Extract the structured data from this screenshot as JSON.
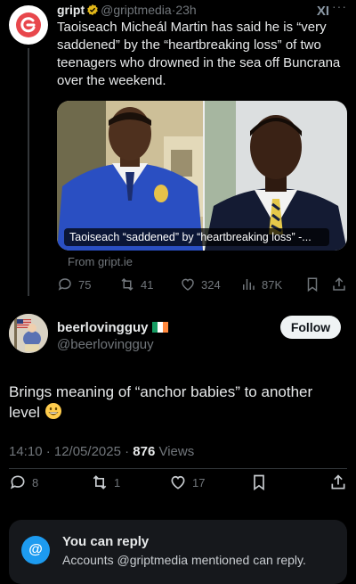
{
  "colors": {
    "background": "#000000",
    "accent": "#1d9bf0",
    "muted": "#71767b",
    "text": "#e7e9ea"
  },
  "original_tweet": {
    "display_name": "gript",
    "handle": "@griptmedia",
    "separator": "·",
    "time": "23h",
    "x_logo": "XI",
    "more": "···",
    "text": "Taoiseach Micheál Martin has said he is “very saddened” by the “heartbreaking loss” of two teenagers who drowned in the sea off Buncrana over the weekend.",
    "media_caption": "Taoiseach “saddened” by “heartbreaking loss” -...",
    "source": "From gript.ie",
    "stats": {
      "replies": "75",
      "reposts": "41",
      "likes": "324",
      "views": "87K"
    }
  },
  "reply": {
    "display_name": "beerlovingguy",
    "handle": "@beerlovingguy",
    "follow_label": "Follow",
    "text": "Brings meaning of “anchor babies” to another level",
    "timestamp": "14:10 · 12/05/2025 · ",
    "views_count": "876",
    "views_label": " Views",
    "stats": {
      "replies": "8",
      "reposts": "1",
      "likes": "17"
    }
  },
  "reply_notice": {
    "title": "You can reply",
    "subtitle": "Accounts @griptmedia mentioned can reply.",
    "icon": "@"
  }
}
